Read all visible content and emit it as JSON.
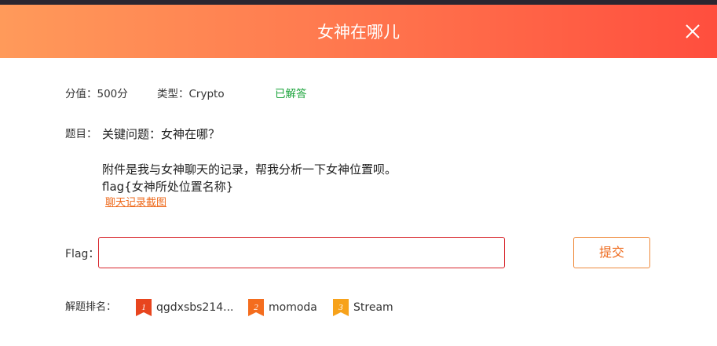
{
  "modal": {
    "title": "女神在哪儿"
  },
  "meta": {
    "score": "分值：500分",
    "type": "类型：Crypto",
    "status": "已解答"
  },
  "question": {
    "label": "题目：",
    "lines": [
      "关键问题：女神在哪？",
      "附件是我与女神聊天的记录，帮我分析一下女神位置呗。",
      "flag{女神所处位置名称}"
    ],
    "attachment_link": "聊天记录截图"
  },
  "flag_form": {
    "label": "Flag：",
    "value": "",
    "placeholder": "",
    "submit_label": "提交"
  },
  "ranking": {
    "label": "解题排名：",
    "items": [
      {
        "rank": "1",
        "name": "qgdxsbs214...",
        "color": "#e8451e"
      },
      {
        "rank": "2",
        "name": "momoda",
        "color": "#f46d1e"
      },
      {
        "rank": "3",
        "name": "Stream",
        "color": "#f7a21b"
      }
    ]
  },
  "icons": {
    "close": "close-icon",
    "badge": "rank-badge-icon"
  }
}
